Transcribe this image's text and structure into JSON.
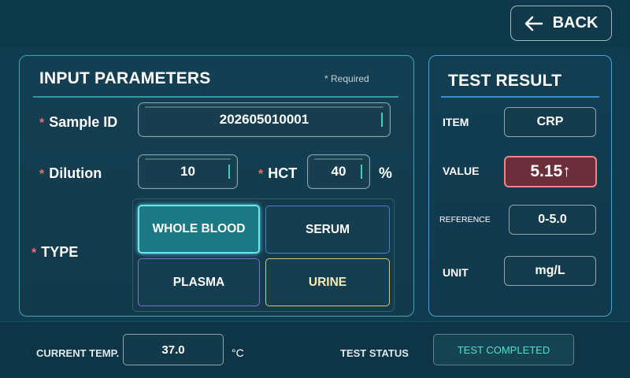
{
  "header": {
    "back_label": "BACK"
  },
  "input_panel": {
    "title": "INPUT PARAMETERS",
    "required_note": "* Required",
    "sample_id": {
      "label": "Sample ID",
      "value": "202605010001"
    },
    "dilution": {
      "label": "Dilution",
      "value": "10"
    },
    "hct": {
      "label": "HCT",
      "value": "40",
      "unit": "%"
    },
    "type": {
      "label": "TYPE",
      "options": [
        "WHOLE BLOOD",
        "SERUM",
        "PLASMA",
        "URINE"
      ],
      "selected": "WHOLE BLOOD"
    },
    "required_marker": "*"
  },
  "result_panel": {
    "title": "TEST RESULT",
    "item": {
      "label": "ITEM",
      "value": "CRP"
    },
    "value": {
      "label": "VALUE",
      "value": "5.15↑"
    },
    "reference": {
      "label": "REFERENCE",
      "value": "0-5.0"
    },
    "unit": {
      "label": "UNIT",
      "value": "mg/L"
    }
  },
  "status_bar": {
    "temp_label": "CURRENT TEMP.",
    "temp_value": "37.0",
    "temp_unit": "°C",
    "status_label": "TEST STATUS",
    "status_value": "TEST COMPLETED"
  },
  "colors": {
    "background": "#0f3d4f",
    "accent": "#3fa6b0",
    "selected": "#1d7a84",
    "alert": "#6a2f3a",
    "status_text": "#4fe2c8",
    "required_star": "#f06d6d"
  }
}
